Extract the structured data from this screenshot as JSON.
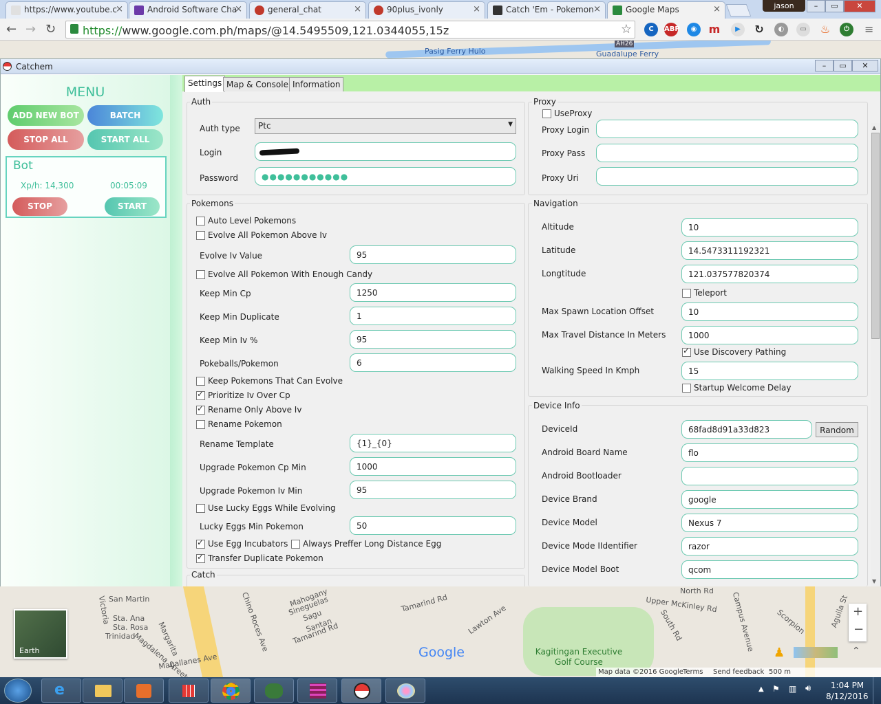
{
  "browser": {
    "tabs": [
      {
        "label": "https://www.youtube.c",
        "color": "#e0e0e0"
      },
      {
        "label": "Android Software Cha",
        "color": "#6c3aa8"
      },
      {
        "label": "general_chat",
        "color": "#c0392b"
      },
      {
        "label": "90plus_ivonly",
        "color": "#c0392b"
      },
      {
        "label": "Catch 'Em - Pokemon",
        "color": "#333333"
      },
      {
        "label": "Google Maps",
        "color": "#2b8a3e"
      }
    ],
    "url_secure": "https://",
    "url_rest": "www.google.com.ph/maps/@14.5495509,121.0344055,15z",
    "user": "jason"
  },
  "app": {
    "title": "Catchem",
    "sidebar": {
      "menu_title": "MENU",
      "add_new_bot": "ADD NEW BOT",
      "batch_creation": "BATCH CREATION",
      "stop_all": "STOP ALL",
      "start_all": "START ALL",
      "bot": {
        "name": "Bot",
        "xph": "Xp/h: 14,300",
        "time": "00:05:09",
        "stop": "STOP",
        "start": "START"
      }
    },
    "tabs": [
      "Settings",
      "Map & Console",
      "Information"
    ],
    "auth": {
      "group": "Auth",
      "auth_type_label": "Auth type",
      "auth_type_value": "Ptc",
      "login_label": "Login",
      "password_label": "Password",
      "password_value": "●●●●●●●●●●●"
    },
    "proxy": {
      "group": "Proxy",
      "use_proxy": "UseProxy",
      "login": "Proxy Login",
      "pass": "Proxy Pass",
      "uri": "Proxy Uri"
    },
    "pokemons": {
      "group": "Pokemons",
      "auto_level": "Auto Level Pokemons",
      "evolve_all_above_iv": "Evolve All Pokemon Above Iv",
      "evolve_iv_value_label": "Evolve Iv Value",
      "evolve_iv_value": "95",
      "evolve_enough_candy": "Evolve All Pokemon With Enough Candy",
      "keep_min_cp_label": "Keep Min Cp",
      "keep_min_cp": "1250",
      "keep_min_dup_label": "Keep Min Duplicate",
      "keep_min_dup": "1",
      "keep_min_iv_label": "Keep Min Iv %",
      "keep_min_iv": "95",
      "pokeballs_label": "Pokeballs/Pokemon",
      "pokeballs": "6",
      "keep_can_evolve": "Keep Pokemons That Can Evolve",
      "prioritize_iv": "Prioritize Iv Over Cp",
      "rename_above_iv": "Rename Only Above Iv",
      "rename_pokemon": "Rename Pokemon",
      "rename_template_label": "Rename Template",
      "rename_template": "{1}_{0}",
      "upgrade_cp_label": "Upgrade Pokemon Cp Min",
      "upgrade_cp": "1000",
      "upgrade_iv_label": "Upgrade Pokemon Iv Min",
      "upgrade_iv": "95",
      "lucky_eggs": "Use Lucky Eggs While Evolving",
      "lucky_min_label": "Lucky Eggs Min Pokemon",
      "lucky_min": "50",
      "egg_incubators": "Use Egg Incubators",
      "long_distance_egg": "Always Preffer Long Distance Egg",
      "transfer_dup": "Transfer Duplicate Pokemon"
    },
    "catch_group": "Catch",
    "navigation": {
      "group": "Navigation",
      "altitude_label": "Altitude",
      "altitude": "10",
      "latitude_label": "Latitude",
      "latitude": "14.5473311192321",
      "longitude_label": "Longtitude",
      "longitude": "121.037577820374",
      "teleport": "Teleport",
      "max_spawn_label": "Max Spawn Location Offset",
      "max_spawn": "10",
      "max_travel_label": "Max Travel Distance In Meters",
      "max_travel": "1000",
      "discovery": "Use Discovery Pathing",
      "walking_label": "Walking Speed In Kmph",
      "walking": "15",
      "startup_delay": "Startup Welcome Delay"
    },
    "device": {
      "group": "Device Info",
      "device_id_label": "DeviceId",
      "device_id": "68fad8d91a33d823",
      "random": "Random",
      "board_label": "Android Board Name",
      "board": "flo",
      "bootloader_label": "Android Bootloader",
      "bootloader": "",
      "brand_label": "Device Brand",
      "brand": "google",
      "model_label": "Device Model",
      "model": "Nexus 7",
      "mode_id_label": "Device Mode IIdentifier",
      "mode_id": "razor",
      "model_boot_label": "Device Model Boot",
      "model_boot": "qcom"
    }
  },
  "map": {
    "top_labels": [
      "Pasig Ferry Hulo",
      "Guadalupe Ferry",
      "AH26"
    ],
    "bottom_labels": [
      "San Martin",
      "Sta. Ana",
      "Sta. Rosa",
      "Trinidad",
      "Mahogany",
      "Sineguelas",
      "Sagu",
      "Santan",
      "Tamarind Rd",
      "Tamarind Rd",
      "Chino Roces Ave",
      "Lawton Ave",
      "Upper McKinley Rd",
      "South Rd",
      "Campus Avenue",
      "Scorpion",
      "Aguila St",
      "Margarita",
      "Magallanes Ave",
      "Magdalena Street",
      "North Rd",
      "Victoria"
    ],
    "earth": "Earth",
    "google": "Google",
    "poi": "Kagitingan Executive Golf Course",
    "footer": [
      "Map data ©2016 Google",
      "Terms",
      "Send feedback",
      "500 m"
    ]
  },
  "taskbar": {
    "time": "1:04 PM",
    "date": "8/12/2016"
  }
}
